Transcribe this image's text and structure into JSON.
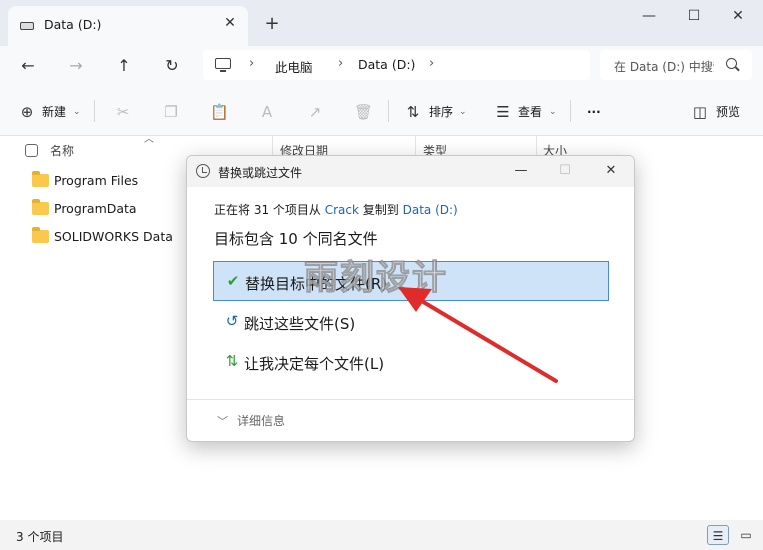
{
  "tab": {
    "title": "Data (D:)",
    "close": "✕",
    "new": "+"
  },
  "window_controls": {
    "minimize": "—",
    "maximize": "☐",
    "close": "✕"
  },
  "nav": {
    "back": "←",
    "forward": "→",
    "up": "↑",
    "refresh": "↻"
  },
  "address": {
    "segments": [
      "此电脑",
      "Data (D:)"
    ],
    "chevron": "›"
  },
  "search": {
    "placeholder": "在 Data (D:) 中搜索"
  },
  "commands": {
    "new_label": "新建",
    "sort_label": "排序",
    "view_label": "查看",
    "more": "···",
    "preview_label": "预览"
  },
  "columns": [
    "名称",
    "修改日期",
    "类型",
    "大小"
  ],
  "files": [
    {
      "name": "Program Files"
    },
    {
      "name": "ProgramData"
    },
    {
      "name": "SOLIDWORKS Data"
    }
  ],
  "status": {
    "item_count": "3 个项目"
  },
  "dialog": {
    "title": "替换或跳过文件",
    "from_prefix": "正在将 31 个项目从",
    "from_source": "Crack",
    "from_mid": "复制到",
    "from_dest": "Data (D:)",
    "main": "目标包含 10 个同名文件",
    "options": [
      {
        "icon": "✔",
        "label": "替换目标中的文件(R)",
        "selected": true
      },
      {
        "icon": "↺",
        "label": "跳过这些文件(S)",
        "selected": false
      },
      {
        "icon": "⇅",
        "label": "让我决定每个文件(L)",
        "selected": false
      }
    ],
    "more_info": "详细信息"
  },
  "watermark": "雨刻设计",
  "colors": {
    "accent": "#1a66b3",
    "selected_bg": "#cfe3f8",
    "arrow": "#e02b2b"
  }
}
